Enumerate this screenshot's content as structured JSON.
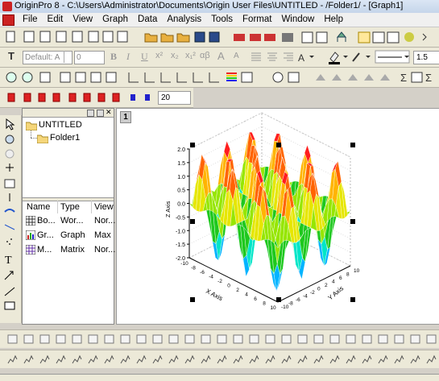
{
  "window": {
    "title": "OriginPro 8 - C:\\Users\\Administrator\\Documents\\Origin User Files\\UNTITLED - /Folder1/ - [Graph1]"
  },
  "menu": [
    "File",
    "Edit",
    "View",
    "Graph",
    "Data",
    "Analysis",
    "Tools",
    "Format",
    "Window",
    "Help"
  ],
  "format_toolbar": {
    "font": "Default: A",
    "size": "0",
    "bold": "B",
    "italic": "I",
    "underline": "U",
    "superscript": "x²",
    "subscript": "x₂",
    "supersub": "x₁²",
    "greek": "αβ",
    "larger": "A",
    "smaller": "A",
    "line_width": "1.5"
  },
  "plot_toolbar": {
    "symbol_size": "20"
  },
  "project": {
    "root": "UNTITLED",
    "folder": "Folder1",
    "columns": [
      "Name",
      "Type",
      "View"
    ],
    "items": [
      {
        "name": "Bo...",
        "type": "Wor...",
        "view": "Nor..."
      },
      {
        "name": "Gr...",
        "type": "Graph",
        "view": "Max"
      },
      {
        "name": "M...",
        "type": "Matrix",
        "view": "Nor..."
      }
    ]
  },
  "graph": {
    "layer_number": "1",
    "z_axis_label": "Z Axis",
    "x_axis_label": "X Axis",
    "y_axis_label": "Y Axis",
    "z_ticks": [
      "2.0",
      "1.5",
      "1.0",
      "0.5",
      "0.0",
      "-0.5",
      "-1.0",
      "-1.5",
      "-2.0"
    ],
    "x_ticks": [
      "-10",
      "-8",
      "-6",
      "-4",
      "-2",
      "0",
      "2",
      "4",
      "6",
      "8",
      "10"
    ],
    "y_ticks": [
      "-10",
      "-8",
      "-6",
      "-4",
      "-2",
      "0",
      "2",
      "4",
      "6",
      "8",
      "10"
    ],
    "colors": [
      "#1a1aff",
      "#00b4ff",
      "#00e6c8",
      "#1ec81e",
      "#96e600",
      "#e6e600",
      "#ffb400",
      "#ff6400",
      "#ff1e1e"
    ]
  }
}
